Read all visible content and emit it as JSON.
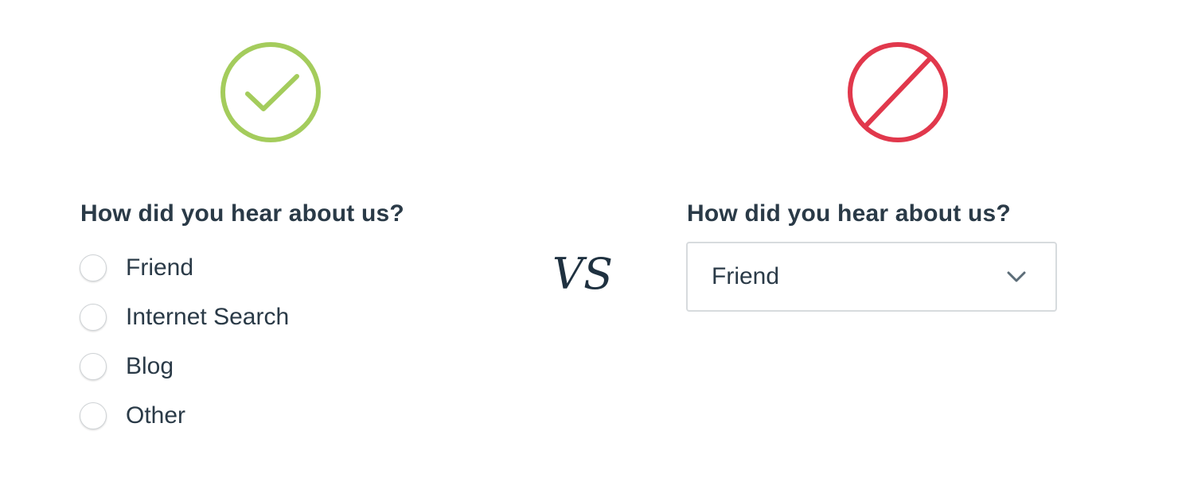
{
  "good_example": {
    "icon": "check-circle-icon",
    "icon_color": "#a4cc5c",
    "question": "How did you hear about us?",
    "options": [
      {
        "label": "Friend"
      },
      {
        "label": "Internet Search"
      },
      {
        "label": "Blog"
      },
      {
        "label": "Other"
      }
    ]
  },
  "separator": {
    "text": "VS"
  },
  "bad_example": {
    "icon": "prohibited-circle-icon",
    "icon_color": "#e1384c",
    "question": "How did you hear about us?",
    "dropdown": {
      "selected_value": "Friend",
      "icon": "chevron-down-icon"
    }
  },
  "colors": {
    "text": "#2a3a47",
    "border": "#d7dbde"
  }
}
